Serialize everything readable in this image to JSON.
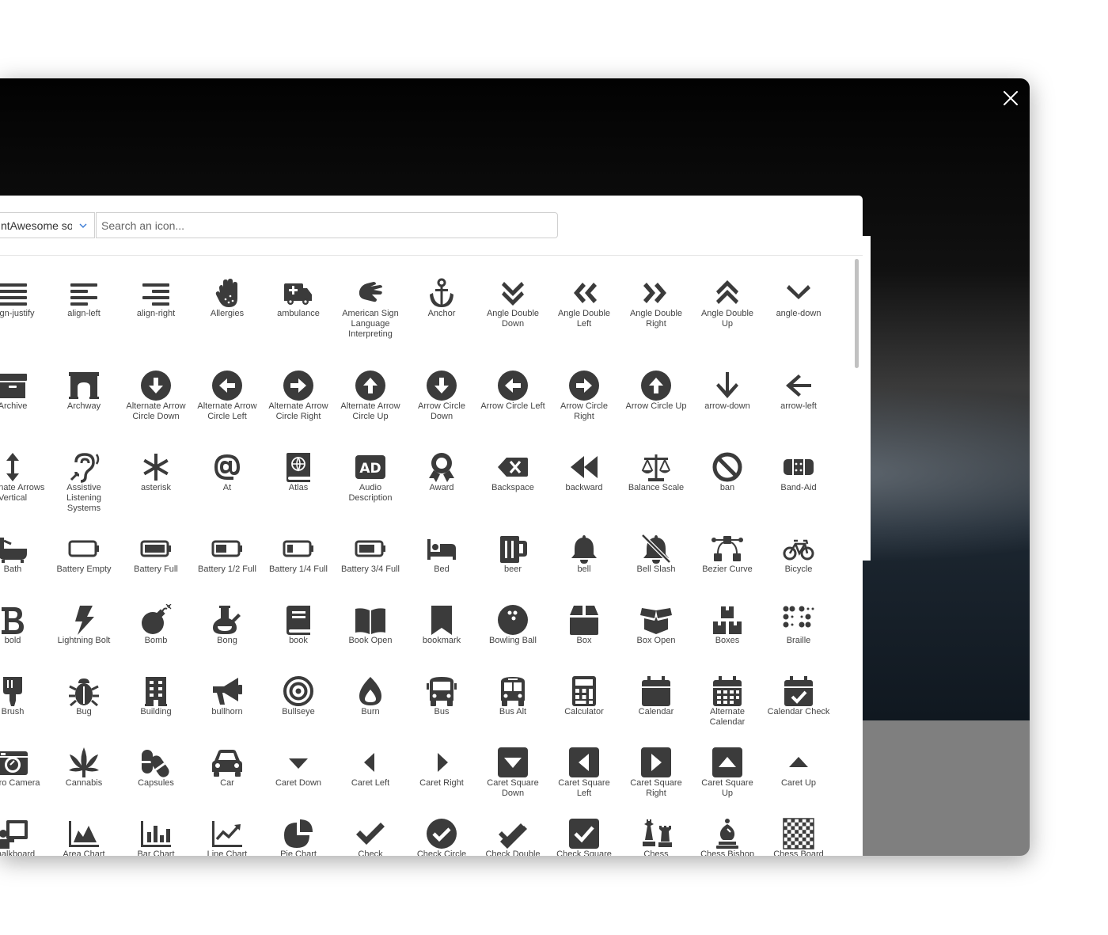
{
  "search": {
    "placeholder": "Search an icon...",
    "value": ""
  },
  "font_select": {
    "value": "ntAwesome sol"
  },
  "colors": {
    "icon": "#3b3b3b",
    "label": "#444444"
  },
  "rows": [
    [
      {
        "label": "align-justify",
        "icon": "align-justify-icon"
      },
      {
        "label": "align-left",
        "icon": "align-left-icon"
      },
      {
        "label": "align-right",
        "icon": "align-right-icon"
      },
      {
        "label": "Allergies",
        "icon": "hand-icon"
      },
      {
        "label": "ambulance",
        "icon": "ambulance-icon"
      },
      {
        "label": "American Sign Language Interpreting",
        "icon": "sign-language-icon"
      },
      {
        "label": "Anchor",
        "icon": "anchor-icon"
      },
      {
        "label": "Angle Double Down",
        "icon": "angle-double-down-icon"
      },
      {
        "label": "Angle Double Left",
        "icon": "angle-double-left-icon"
      },
      {
        "label": "Angle Double Right",
        "icon": "angle-double-right-icon"
      },
      {
        "label": "Angle Double Up",
        "icon": "angle-double-up-icon"
      },
      {
        "label": "angle-down",
        "icon": "angle-down-icon"
      }
    ],
    [
      {
        "label": "Archive",
        "icon": "archive-icon"
      },
      {
        "label": "Archway",
        "icon": "archway-icon"
      },
      {
        "label": "Alternate Arrow Circle Down",
        "icon": "arrow-circle-down-icon"
      },
      {
        "label": "Alternate Arrow Circle Left",
        "icon": "arrow-circle-left-icon"
      },
      {
        "label": "Alternate Arrow Circle Right",
        "icon": "arrow-circle-right-icon"
      },
      {
        "label": "Alternate Arrow Circle Up",
        "icon": "arrow-circle-up-icon"
      },
      {
        "label": "Arrow Circle Down",
        "icon": "arrow-circle-down-icon"
      },
      {
        "label": "Arrow Circle Left",
        "icon": "arrow-circle-left-icon"
      },
      {
        "label": "Arrow Circle Right",
        "icon": "arrow-circle-right-icon"
      },
      {
        "label": "Arrow Circle Up",
        "icon": "arrow-circle-up-icon"
      },
      {
        "label": "arrow-down",
        "icon": "arrow-down-icon"
      },
      {
        "label": "arrow-left",
        "icon": "arrow-left-icon"
      }
    ],
    [
      {
        "label": "Alternate Arrows Vertical",
        "icon": "arrows-vertical-icon"
      },
      {
        "label": "Assistive Listening Systems",
        "icon": "ear-icon"
      },
      {
        "label": "asterisk",
        "icon": "asterisk-icon"
      },
      {
        "label": "At",
        "icon": "at-icon"
      },
      {
        "label": "Atlas",
        "icon": "atlas-icon"
      },
      {
        "label": "Audio Description",
        "icon": "audio-description-icon"
      },
      {
        "label": "Award",
        "icon": "award-icon"
      },
      {
        "label": "Backspace",
        "icon": "backspace-icon"
      },
      {
        "label": "backward",
        "icon": "backward-icon"
      },
      {
        "label": "Balance Scale",
        "icon": "balance-scale-icon"
      },
      {
        "label": "ban",
        "icon": "ban-icon"
      },
      {
        "label": "Band-Aid",
        "icon": "band-aid-icon"
      }
    ],
    [
      {
        "label": "Bath",
        "icon": "bath-icon"
      },
      {
        "label": "Battery Empty",
        "icon": "battery-empty-icon"
      },
      {
        "label": "Battery Full",
        "icon": "battery-full-icon"
      },
      {
        "label": "Battery 1/2 Full",
        "icon": "battery-half-icon"
      },
      {
        "label": "Battery 1/4 Full",
        "icon": "battery-quarter-icon"
      },
      {
        "label": "Battery 3/4 Full",
        "icon": "battery-three-quarters-icon"
      },
      {
        "label": "Bed",
        "icon": "bed-icon"
      },
      {
        "label": "beer",
        "icon": "beer-icon"
      },
      {
        "label": "bell",
        "icon": "bell-icon"
      },
      {
        "label": "Bell Slash",
        "icon": "bell-slash-icon"
      },
      {
        "label": "Bezier Curve",
        "icon": "bezier-curve-icon"
      },
      {
        "label": "Bicycle",
        "icon": "bicycle-icon"
      }
    ],
    [
      {
        "label": "bold",
        "icon": "bold-icon"
      },
      {
        "label": "Lightning Bolt",
        "icon": "bolt-icon"
      },
      {
        "label": "Bomb",
        "icon": "bomb-icon"
      },
      {
        "label": "Bong",
        "icon": "bong-icon"
      },
      {
        "label": "book",
        "icon": "book-icon"
      },
      {
        "label": "Book Open",
        "icon": "book-open-icon"
      },
      {
        "label": "bookmark",
        "icon": "bookmark-icon"
      },
      {
        "label": "Bowling Ball",
        "icon": "bowling-ball-icon"
      },
      {
        "label": "Box",
        "icon": "box-icon"
      },
      {
        "label": "Box Open",
        "icon": "box-open-icon"
      },
      {
        "label": "Boxes",
        "icon": "boxes-icon"
      },
      {
        "label": "Braille",
        "icon": "braille-icon"
      }
    ],
    [
      {
        "label": "Brush",
        "icon": "brush-icon"
      },
      {
        "label": "Bug",
        "icon": "bug-icon"
      },
      {
        "label": "Building",
        "icon": "building-icon"
      },
      {
        "label": "bullhorn",
        "icon": "bullhorn-icon"
      },
      {
        "label": "Bullseye",
        "icon": "bullseye-icon"
      },
      {
        "label": "Burn",
        "icon": "burn-icon"
      },
      {
        "label": "Bus",
        "icon": "bus-icon"
      },
      {
        "label": "Bus Alt",
        "icon": "bus-alt-icon"
      },
      {
        "label": "Calculator",
        "icon": "calculator-icon"
      },
      {
        "label": "Calendar",
        "icon": "calendar-icon"
      },
      {
        "label": "Alternate Calendar",
        "icon": "calendar-alt-icon"
      },
      {
        "label": "Calendar Check",
        "icon": "calendar-check-icon"
      }
    ],
    [
      {
        "label": "Retro Camera",
        "icon": "camera-retro-icon"
      },
      {
        "label": "Cannabis",
        "icon": "cannabis-icon"
      },
      {
        "label": "Capsules",
        "icon": "capsules-icon"
      },
      {
        "label": "Car",
        "icon": "car-icon"
      },
      {
        "label": "Caret Down",
        "icon": "caret-down-icon"
      },
      {
        "label": "Caret Left",
        "icon": "caret-left-icon"
      },
      {
        "label": "Caret Right",
        "icon": "caret-right-icon"
      },
      {
        "label": "Caret Square Down",
        "icon": "caret-square-down-icon"
      },
      {
        "label": "Caret Square Left",
        "icon": "caret-square-left-icon"
      },
      {
        "label": "Caret Square Right",
        "icon": "caret-square-right-icon"
      },
      {
        "label": "Caret Square Up",
        "icon": "caret-square-up-icon"
      },
      {
        "label": "Caret Up",
        "icon": "caret-up-icon"
      }
    ],
    [
      {
        "label": "Chalkboard Teacher",
        "icon": "chalkboard-teacher-icon"
      },
      {
        "label": "Area Chart",
        "icon": "area-chart-icon"
      },
      {
        "label": "Bar Chart",
        "icon": "bar-chart-icon"
      },
      {
        "label": "Line Chart",
        "icon": "line-chart-icon"
      },
      {
        "label": "Pie Chart",
        "icon": "pie-chart-icon"
      },
      {
        "label": "Check",
        "icon": "check-icon"
      },
      {
        "label": "Check Circle",
        "icon": "check-circle-icon"
      },
      {
        "label": "Check Double",
        "icon": "check-double-icon"
      },
      {
        "label": "Check Square",
        "icon": "check-square-icon"
      },
      {
        "label": "Chess",
        "icon": "chess-icon"
      },
      {
        "label": "Chess Bishop",
        "icon": "chess-bishop-icon"
      },
      {
        "label": "Chess Board",
        "icon": "chess-board-icon"
      }
    ]
  ]
}
